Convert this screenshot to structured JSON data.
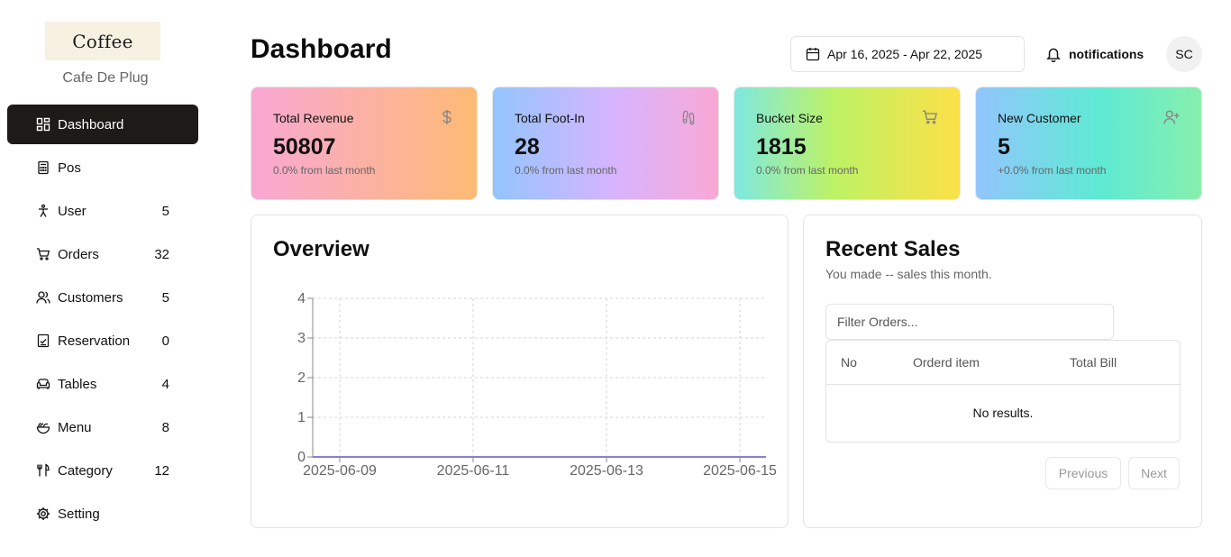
{
  "sidebar": {
    "logo": "Coffee",
    "brand": "Cafe De Plug",
    "items": [
      {
        "label": "Dashboard",
        "count": "",
        "icon": "dashboard-icon"
      },
      {
        "label": "Pos",
        "count": "",
        "icon": "calculator-icon"
      },
      {
        "label": "User",
        "count": "5",
        "icon": "person-icon"
      },
      {
        "label": "Orders",
        "count": "32",
        "icon": "cart-icon"
      },
      {
        "label": "Customers",
        "count": "5",
        "icon": "users-icon"
      },
      {
        "label": "Reservation",
        "count": "0",
        "icon": "clipboard-check-icon"
      },
      {
        "label": "Tables",
        "count": "4",
        "icon": "sofa-icon"
      },
      {
        "label": "Menu",
        "count": "8",
        "icon": "salad-icon"
      },
      {
        "label": "Category",
        "count": "12",
        "icon": "utensils-icon"
      },
      {
        "label": "Setting",
        "count": "",
        "icon": "gear-icon"
      }
    ]
  },
  "header": {
    "title": "Dashboard",
    "date_range": "Apr 16, 2025 - Apr 22, 2025",
    "notifications": "notifications",
    "avatar": "SC"
  },
  "cards": [
    {
      "title": "Total Revenue",
      "value": "50807",
      "sub": "0.0% from last month",
      "icon": "dollar-icon"
    },
    {
      "title": "Total Foot-In",
      "value": "28",
      "sub": "0.0% from last month",
      "icon": "footprints-icon"
    },
    {
      "title": "Bucket Size",
      "value": "1815",
      "sub": "0.0% from last month",
      "icon": "cart-icon"
    },
    {
      "title": "New Customer",
      "value": "5",
      "sub": "+0.0% from last month",
      "icon": "user-plus-icon"
    }
  ],
  "overview": {
    "title": "Overview"
  },
  "chart_data": {
    "type": "line",
    "x": [
      "2025-06-09",
      "2025-06-11",
      "2025-06-13",
      "2025-06-15"
    ],
    "series": [
      {
        "values": [
          0,
          0,
          0,
          0
        ]
      }
    ],
    "yticks": [
      "0",
      "1",
      "2",
      "3",
      "4"
    ],
    "ylim": [
      0,
      4
    ],
    "grid": true,
    "line_color": "#8b7fd1"
  },
  "sales": {
    "title": "Recent Sales",
    "subtitle": "You made -- sales this month.",
    "filter_placeholder": "Filter Orders...",
    "columns": [
      "No",
      "Orderd item",
      "Total Bill"
    ],
    "empty": "No results.",
    "prev": "Previous",
    "next": "Next"
  }
}
